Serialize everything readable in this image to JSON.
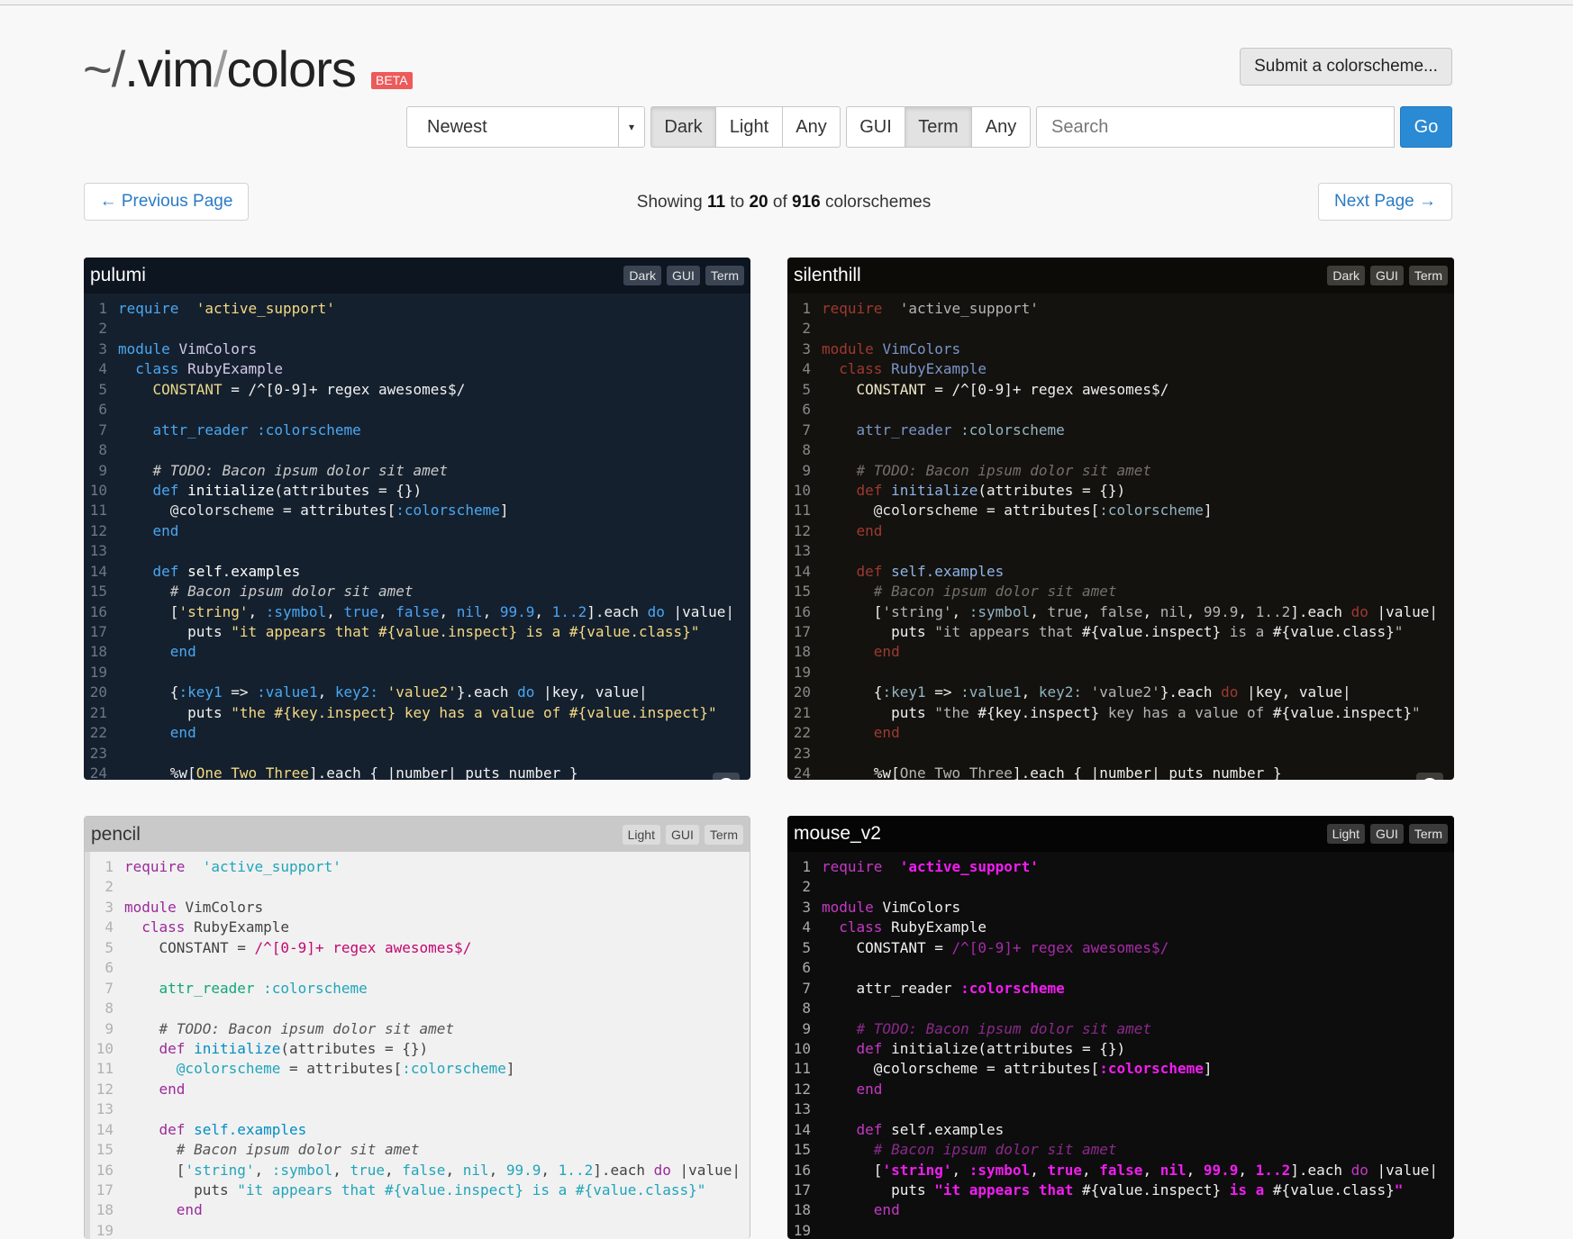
{
  "header": {
    "logo_tilde": "~/",
    "logo_dot": ".vim",
    "logo_slash": "/",
    "logo_colors": "colors",
    "beta_badge": "BETA",
    "submit_label": "Submit a colorscheme..."
  },
  "filters": {
    "sort_value": "Newest",
    "background_options": [
      "Dark",
      "Light",
      "Any"
    ],
    "background_selected": "Dark",
    "editor_options": [
      "GUI",
      "Term",
      "Any"
    ],
    "editor_selected": "Term",
    "search_placeholder": "Search",
    "go_label": "Go"
  },
  "pagination": {
    "prev_label": "← Previous Page",
    "next_label": "Next Page →",
    "showing_prefix": "Showing",
    "from": "11",
    "to_word": "to",
    "to": "20",
    "of_word": "of",
    "total": "916",
    "suffix": "colorschemes"
  },
  "code_sample": [
    [
      [
        "kw",
        "require"
      ],
      [
        "",
        "  "
      ],
      [
        "st",
        "'active_support'"
      ]
    ],
    [],
    [
      [
        "kw",
        "module"
      ],
      [
        "",
        " "
      ],
      [
        "cl",
        "VimColors"
      ]
    ],
    [
      [
        "",
        ""
      ],
      [
        "kw",
        "  class"
      ],
      [
        "",
        " "
      ],
      [
        "cl",
        "RubyExample"
      ]
    ],
    [
      [
        "ct",
        "    CONSTANT"
      ],
      [
        "",
        " = "
      ],
      [
        "re",
        "/^[0-9]+ regex awesomes$/"
      ]
    ],
    [],
    [
      [
        "sp",
        "    attr_reader"
      ],
      [
        "",
        " "
      ],
      [
        "sy",
        ":colorscheme"
      ]
    ],
    [],
    [
      [
        "cm",
        "    # TODO: Bacon ipsum dolor sit amet"
      ]
    ],
    [
      [
        "kw",
        "    def"
      ],
      [
        "",
        " "
      ],
      [
        "fn",
        "initialize"
      ],
      [
        "",
        "(attributes = {})"
      ]
    ],
    [
      [
        "iv",
        "      @colorscheme"
      ],
      [
        "",
        " = attributes["
      ],
      [
        "sy",
        ":colorscheme"
      ],
      [
        "",
        "]"
      ]
    ],
    [
      [
        "kw",
        "    end"
      ]
    ],
    [],
    [
      [
        "kw",
        "    def"
      ],
      [
        "",
        " "
      ],
      [
        "fn",
        "self.examples"
      ]
    ],
    [
      [
        "cm",
        "      # Bacon ipsum dolor sit amet"
      ]
    ],
    [
      [
        "",
        "      ["
      ],
      [
        "st",
        "'string'"
      ],
      [
        "",
        ", "
      ],
      [
        "sy",
        ":symbol"
      ],
      [
        "",
        ", "
      ],
      [
        "nu",
        "true"
      ],
      [
        "",
        ", "
      ],
      [
        "nu",
        "false"
      ],
      [
        "",
        ", "
      ],
      [
        "nu",
        "nil"
      ],
      [
        "",
        ", "
      ],
      [
        "nu",
        "99.9"
      ],
      [
        "",
        ", "
      ],
      [
        "nu",
        "1..2"
      ],
      [
        "",
        "].each "
      ],
      [
        "kw",
        "do"
      ],
      [
        "",
        " |value|"
      ]
    ],
    [
      [
        "",
        "        puts "
      ],
      [
        "st",
        "\"it appears that "
      ],
      [
        "ip",
        "#{value.inspect}"
      ],
      [
        "st",
        " is a "
      ],
      [
        "ip",
        "#{value.class}"
      ],
      [
        "st",
        "\""
      ]
    ],
    [
      [
        "kw",
        "      end"
      ]
    ],
    [],
    [
      [
        "",
        "      {"
      ],
      [
        "sy",
        ":key1"
      ],
      [
        "",
        " => "
      ],
      [
        "sy",
        ":value1"
      ],
      [
        "",
        ", "
      ],
      [
        "sy",
        "key2:"
      ],
      [
        "",
        " "
      ],
      [
        "st",
        "'value2'"
      ],
      [
        "",
        "}.each "
      ],
      [
        "kw",
        "do"
      ],
      [
        "",
        " |key, value|"
      ]
    ],
    [
      [
        "",
        "        puts "
      ],
      [
        "st",
        "\"the "
      ],
      [
        "ip",
        "#{key.inspect}"
      ],
      [
        "st",
        " key has a value of "
      ],
      [
        "ip",
        "#{value.inspect}"
      ],
      [
        "st",
        "\""
      ]
    ],
    [
      [
        "kw",
        "      end"
      ]
    ],
    [],
    [
      [
        "",
        "      %w["
      ],
      [
        "st",
        "One Two Three"
      ],
      [
        "",
        "].each { |number| puts number }"
      ]
    ]
  ],
  "cards": [
    {
      "id": "pulumi",
      "name": "pulumi",
      "tags": [
        "Dark",
        "GUI",
        "Term"
      ],
      "lines": 24,
      "colors": {
        "bg": "#15202e",
        "accent": "#49a8f2"
      }
    },
    {
      "id": "silenthill",
      "name": "silenthill",
      "tags": [
        "Dark",
        "GUI",
        "Term"
      ],
      "lines": 24,
      "colors": {
        "bg": "#13120e",
        "accent": "#9e3a30"
      }
    },
    {
      "id": "pencil",
      "name": "pencil",
      "tags": [
        "Light",
        "GUI",
        "Term"
      ],
      "lines": 19,
      "colors": {
        "bg": "#f1f1f1",
        "accent": "#20a5ba"
      }
    },
    {
      "id": "mouse",
      "name": "mouse_v2",
      "tags": [
        "Light",
        "GUI",
        "Term"
      ],
      "lines": 19,
      "colors": {
        "bg": "#0d0d0d",
        "accent": "#f31cf3"
      }
    }
  ],
  "icons": {
    "github": "github-icon",
    "caret": "caret-down-icon"
  }
}
